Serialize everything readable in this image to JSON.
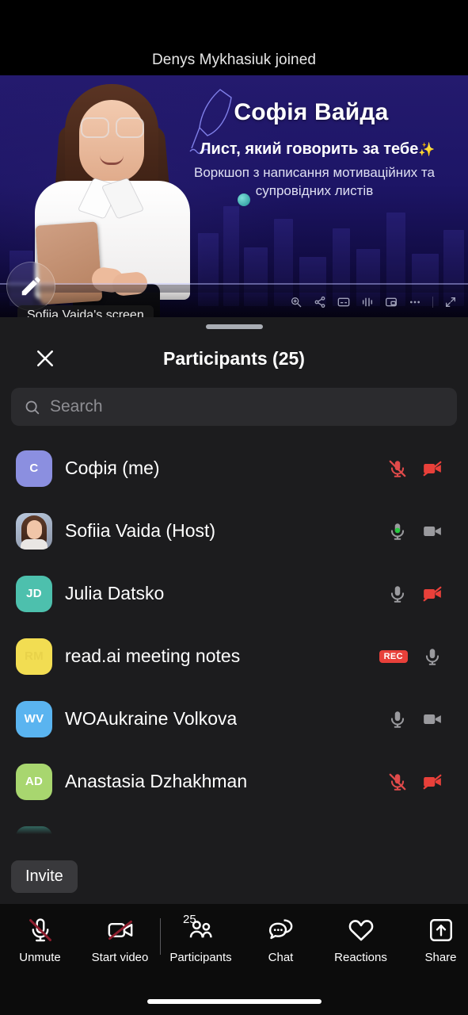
{
  "notification": {
    "text": "Denys Mykhasiuk joined"
  },
  "shared_screen": {
    "label": "Sofiia Vaida's screen",
    "annotate_icon": "pencil-icon",
    "slide": {
      "title": "Софія Вайда",
      "subtitle": "Лист, який говорить за тебе",
      "sparkle": "✨",
      "description": "Воркшоп з написання мотиваційних та супровідних листів",
      "background_color": "#1d1566",
      "title_color": "#ffffff"
    },
    "player_controls": [
      {
        "name": "zoom-icon",
        "label": "Zoom"
      },
      {
        "name": "share-node-icon",
        "label": "Share"
      },
      {
        "name": "subtitles-icon",
        "label": "Subtitles"
      },
      {
        "name": "audio-track-icon",
        "label": "Audio"
      },
      {
        "name": "picture-in-picture-icon",
        "label": "Picture in picture"
      },
      {
        "name": "more-options-icon",
        "label": "More"
      },
      {
        "name": "fullscreen-icon",
        "label": "Fullscreen"
      }
    ]
  },
  "panel": {
    "title": "Participants (25)",
    "close_icon": "close-icon",
    "search": {
      "placeholder": "Search",
      "value": "",
      "icon": "search-icon"
    },
    "invite_label": "Invite",
    "participants": [
      {
        "name": "Софія (me)",
        "avatar_type": "initials",
        "initials": "C",
        "avatar_color": "#8b8fe0",
        "mic": "muted",
        "video": "off"
      },
      {
        "name": "Sofiia Vaida (Host)",
        "avatar_type": "photo",
        "initials": "",
        "avatar_color": "#94a3b5",
        "mic": "speaking",
        "video": "on"
      },
      {
        "name": "Julia Datsko",
        "avatar_type": "initials",
        "initials": "JD",
        "avatar_color": "#4dc0ad",
        "mic": "unmuted",
        "video": "off"
      },
      {
        "name": "read.ai meeting notes",
        "avatar_type": "initials",
        "initials": "RM",
        "avatar_color": "#f2dd52",
        "badge": "REC",
        "mic": "unmuted",
        "video": "none"
      },
      {
        "name": "WOAukraine Volkova",
        "avatar_type": "initials",
        "initials": "WV",
        "avatar_color": "#5ab4f0",
        "mic": "unmuted",
        "video": "on"
      },
      {
        "name": "Anastasia Dzhakhman",
        "avatar_type": "initials",
        "initials": "AD",
        "avatar_color": "#a8d66f",
        "mic": "muted",
        "video": "off"
      },
      {
        "name": "",
        "avatar_type": "initials",
        "initials": "",
        "avatar_color": "#4dc0ad",
        "mic": "muted",
        "video": "off"
      }
    ]
  },
  "toolbar": {
    "items": [
      {
        "label": "Unmute",
        "icon": "mic-off-icon",
        "badge": ""
      },
      {
        "label": "Start video",
        "icon": "video-off-icon",
        "badge": ""
      },
      {
        "label": "Participants",
        "icon": "participants-icon",
        "badge": "25"
      },
      {
        "label": "Chat",
        "icon": "chat-icon",
        "badge": ""
      },
      {
        "label": "Reactions",
        "icon": "heart-icon",
        "badge": ""
      },
      {
        "label": "Share",
        "icon": "share-icon",
        "badge": ""
      }
    ],
    "slash_color": "#8e1e2e"
  }
}
